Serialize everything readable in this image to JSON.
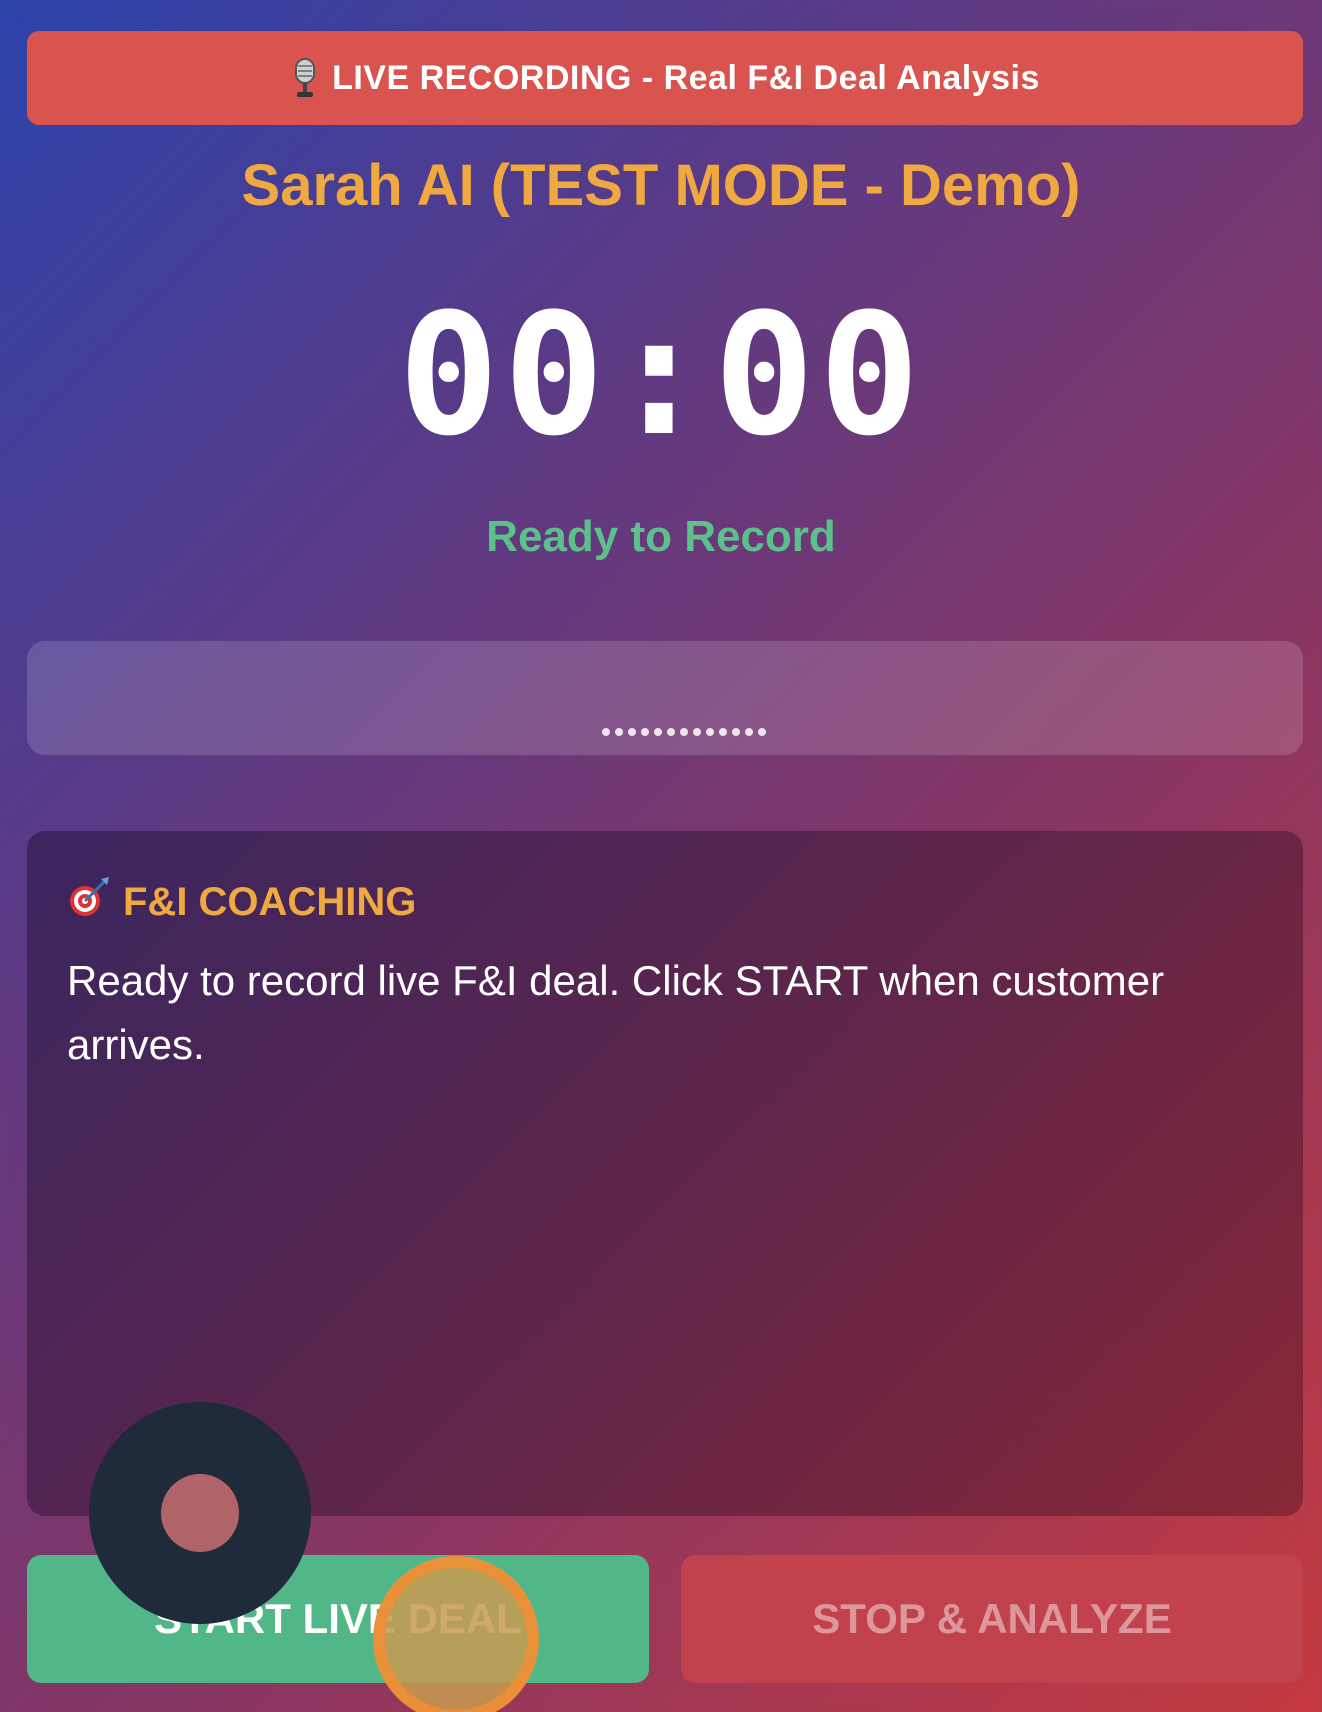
{
  "banner": {
    "icon": "microphone-icon",
    "text": "LIVE RECORDING - Real F&I Deal Analysis",
    "color": "#d9534f"
  },
  "header": {
    "title": "Sarah AI (TEST MODE - Demo)",
    "title_color": "#f0a840"
  },
  "timer": {
    "value": "00:00"
  },
  "status": {
    "text": "Ready to Record",
    "color": "#5cc08a"
  },
  "coaching": {
    "icon": "target-icon",
    "heading": "F&I COACHING",
    "message": "Ready to record live F&I deal. Click START when customer arrives."
  },
  "buttons": {
    "start_label": "START LIVE DEAL",
    "stop_label": "STOP & ANALYZE",
    "start_color": "#52b788",
    "stop_color": "#c1424c"
  }
}
